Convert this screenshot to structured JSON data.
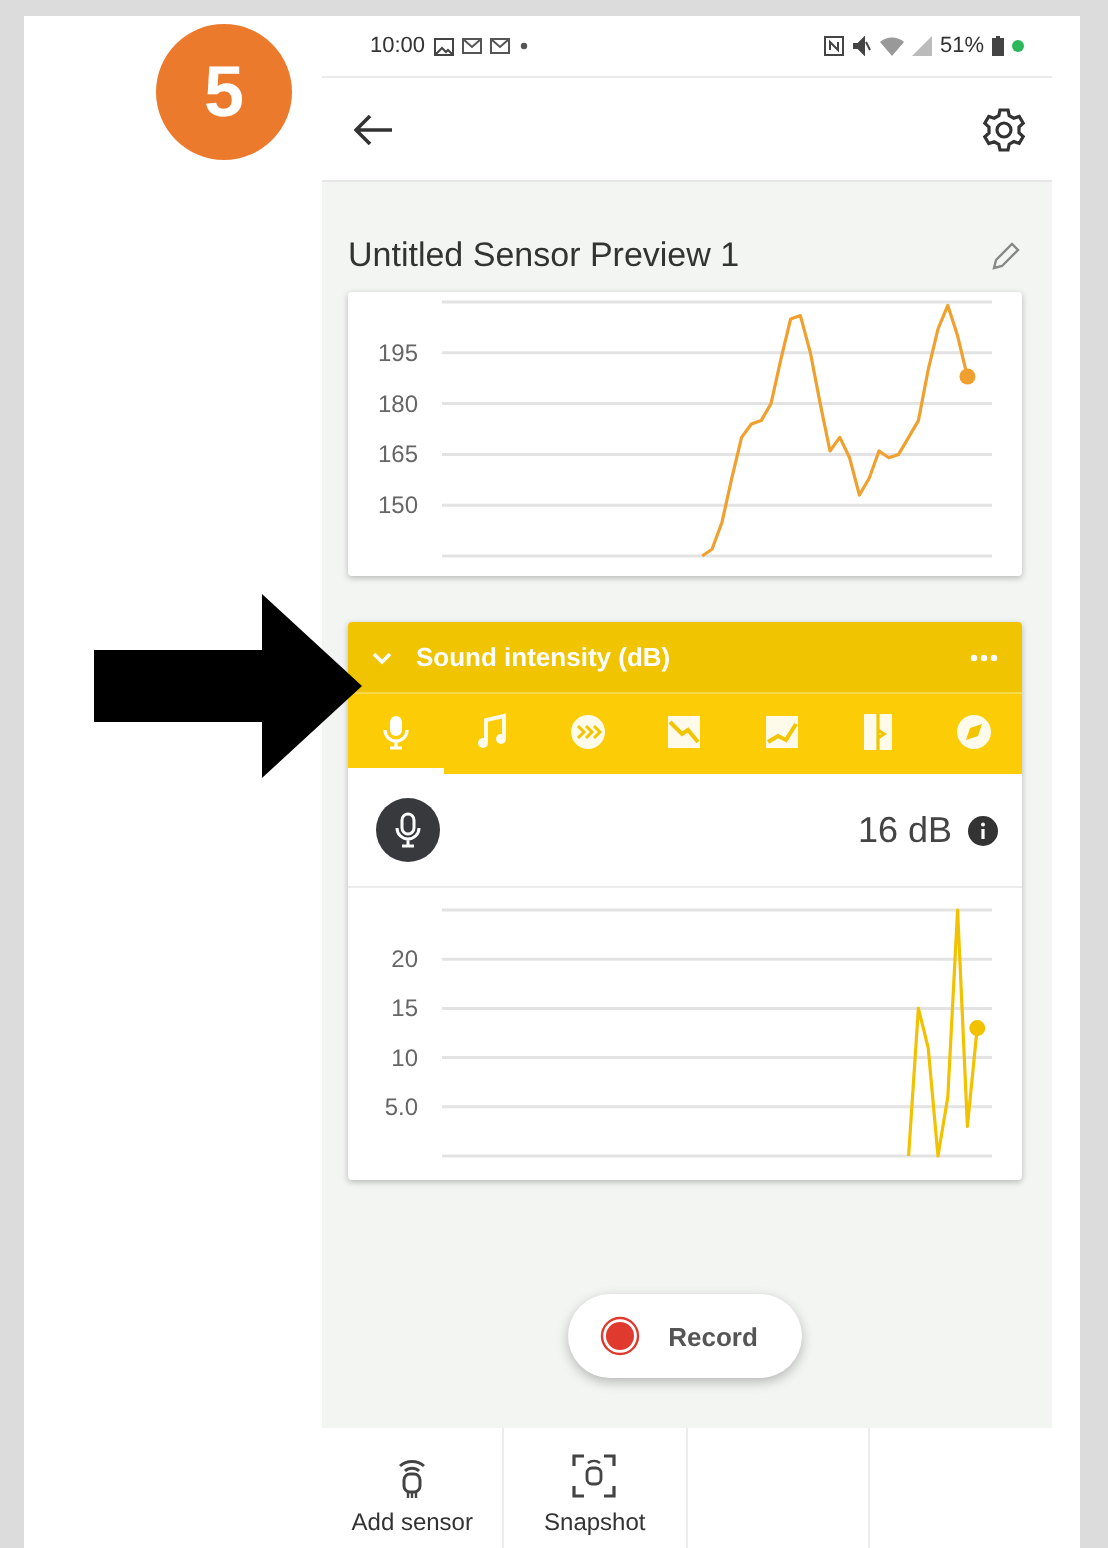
{
  "step_badge": "5",
  "status_bar": {
    "time": "10:00",
    "battery": "51%"
  },
  "page": {
    "title": "Untitled Sensor Preview 1"
  },
  "cards": [
    {
      "kind": "chart",
      "chart_data": {
        "type": "line",
        "categories": [
          null,
          null,
          null,
          null,
          null,
          null,
          null,
          null,
          null,
          null,
          null,
          null,
          null,
          null,
          null,
          null,
          null,
          null,
          null,
          null,
          null,
          null,
          null,
          null,
          null,
          null,
          null,
          null,
          null,
          null,
          null,
          null,
          null,
          null,
          null,
          null,
          null,
          null,
          null,
          null,
          null,
          null,
          null,
          null,
          null,
          null,
          null,
          null,
          null,
          null,
          null,
          null,
          null,
          null,
          null,
          null
        ],
        "grid": true,
        "ylim": [
          135,
          210
        ],
        "yticks": [
          150,
          165,
          180,
          195
        ],
        "series": [
          {
            "color": "#f0a02e",
            "values": [
              null,
              null,
              null,
              null,
              null,
              null,
              null,
              null,
              null,
              null,
              null,
              null,
              null,
              null,
              null,
              null,
              null,
              null,
              null,
              null,
              null,
              null,
              null,
              null,
              null,
              null,
              135,
              137,
              145,
              158,
              170,
              174,
              175,
              180,
              193,
              205,
              206,
              195,
              180,
              166,
              170,
              164,
              153,
              158,
              166,
              164,
              165,
              170,
              175,
              190,
              202,
              209,
              200,
              188,
              null,
              null
            ]
          }
        ]
      }
    },
    {
      "kind": "sensor",
      "title": "Sound intensity (dB)",
      "expanded": true,
      "tabs": [
        {
          "kind": "microphone",
          "selected": true
        },
        {
          "kind": "note",
          "selected": false
        },
        {
          "kind": "counter",
          "selected": false
        },
        {
          "kind": "descend",
          "selected": false
        },
        {
          "kind": "ascend",
          "selected": false
        },
        {
          "kind": "meter",
          "selected": false
        },
        {
          "kind": "compass",
          "selected": false
        }
      ],
      "reading": "16 dB",
      "chart_data": {
        "type": "line",
        "categories": [
          null,
          null,
          null,
          null,
          null,
          null,
          null,
          null,
          null,
          null,
          null,
          null,
          null,
          null,
          null,
          null,
          null,
          null,
          null,
          null,
          null,
          null,
          null,
          null,
          null,
          null,
          null,
          null,
          null,
          null,
          null,
          null,
          null,
          null,
          null,
          null,
          null,
          null,
          null,
          null,
          null,
          null,
          null,
          null,
          null,
          null,
          null,
          null,
          null,
          null,
          null,
          null,
          null,
          null,
          null,
          null
        ],
        "grid": true,
        "ylim": [
          0,
          25
        ],
        "yticks": [
          {
            "value": 5,
            "label": "5.0"
          },
          10,
          15,
          20
        ],
        "series": [
          {
            "color": "#f2c200",
            "values": [
              null,
              null,
              null,
              null,
              null,
              null,
              null,
              null,
              null,
              null,
              null,
              null,
              null,
              null,
              null,
              null,
              null,
              null,
              null,
              null,
              null,
              null,
              null,
              null,
              null,
              null,
              null,
              null,
              null,
              null,
              null,
              null,
              null,
              null,
              null,
              null,
              null,
              null,
              null,
              null,
              null,
              null,
              null,
              null,
              null,
              null,
              null,
              0,
              15,
              11,
              0,
              6,
              25,
              3,
              13,
              null
            ]
          }
        ]
      }
    }
  ],
  "record_button": {
    "label": "Record"
  },
  "bottom_bar": [
    {
      "kind": "sensor",
      "label": "Add sensor"
    },
    {
      "kind": "snapshot",
      "label": "Snapshot"
    }
  ]
}
